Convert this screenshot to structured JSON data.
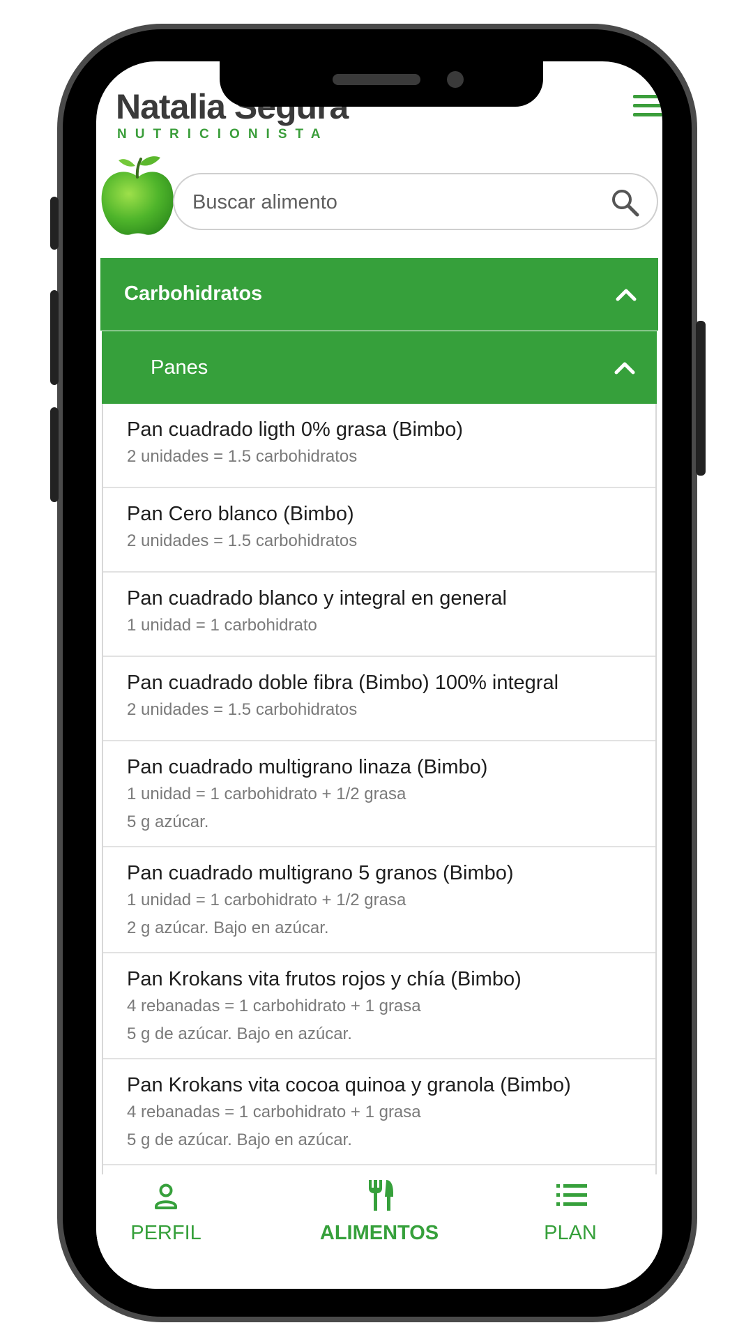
{
  "header": {
    "brand_name": "Natalia Segura",
    "brand_subtitle": "NUTRICIONISTA",
    "menu_icon": "hamburger-menu-icon",
    "logo_icon": "apple-icon"
  },
  "search": {
    "placeholder": "Buscar alimento",
    "value": "",
    "icon": "search-icon"
  },
  "category": {
    "label": "Carbohidratos",
    "expanded": true,
    "subcategory": {
      "label": "Panes",
      "expanded": true
    }
  },
  "foods": [
    {
      "title": "Pan cuadrado ligth 0% grasa (Bimbo)",
      "lines": [
        "2 unidades = 1.5 carbohidratos"
      ]
    },
    {
      "title": "Pan Cero blanco (Bimbo)",
      "lines": [
        "2 unidades = 1.5 carbohidratos"
      ]
    },
    {
      "title": "Pan cuadrado blanco y integral en general",
      "lines": [
        "1 unidad = 1 carbohidrato"
      ]
    },
    {
      "title": "Pan cuadrado doble fibra (Bimbo) 100% integral",
      "lines": [
        "2 unidades = 1.5 carbohidratos"
      ]
    },
    {
      "title": "Pan cuadrado multigrano linaza (Bimbo)",
      "lines": [
        "1 unidad = 1 carbohidrato + 1/2 grasa",
        "5 g azúcar."
      ]
    },
    {
      "title": "Pan cuadrado multigrano 5 granos (Bimbo)",
      "lines": [
        "1 unidad = 1 carbohidrato + 1/2 grasa",
        "2 g azúcar. Bajo en azúcar."
      ]
    },
    {
      "title": "Pan Krokans vita frutos rojos y chía (Bimbo)",
      "lines": [
        "4 rebanadas = 1 carbohidrato + 1 grasa",
        "5 g de azúcar. Bajo en azúcar."
      ]
    },
    {
      "title": "Pan Krokans vita cocoa quinoa y granola (Bimbo)",
      "lines": [
        "4 rebanadas = 1 carbohidrato + 1 grasa",
        "5 g de azúcar. Bajo en azúcar."
      ]
    }
  ],
  "bottom_nav": {
    "perfil": {
      "label": "PERFIL",
      "icon": "person-icon"
    },
    "alimentos": {
      "label": "ALIMENTOS",
      "icon": "utensils-icon",
      "active": true
    },
    "plan": {
      "label": "PLAN",
      "icon": "list-icon"
    }
  },
  "colors": {
    "accent": "#36a03b",
    "frame": "#000000"
  }
}
